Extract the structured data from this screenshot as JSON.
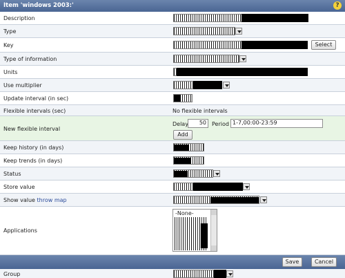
{
  "header": {
    "title": "Item 'windows 2003:'",
    "help": "?"
  },
  "rows": {
    "description": "Description",
    "type": "Type",
    "key": "Key",
    "select": "Select",
    "type_info": "Type of information",
    "units": "Units",
    "multiplier": "Use multiplier",
    "update_interval": "Update interval (in sec)",
    "flexible_intervals": "Flexible intervals (sec)",
    "no_flexible": "No flexible intervals",
    "new_flexible": "New flexible interval",
    "delay_label": "Delay",
    "delay_value": "50",
    "period_label": "Period",
    "period_value": "1-7,00:00-23:59",
    "add": "Add",
    "keep_history": "Keep history (in days)",
    "keep_trends": "Keep trends (in days)",
    "status": "Status",
    "store_value": "Store value",
    "show_value": "Show value",
    "throw_map": "throw map",
    "applications": "Applications",
    "none_option": "-None-",
    "group": "Group"
  },
  "footer": {
    "save": "Save",
    "cancel": "Cancel"
  }
}
